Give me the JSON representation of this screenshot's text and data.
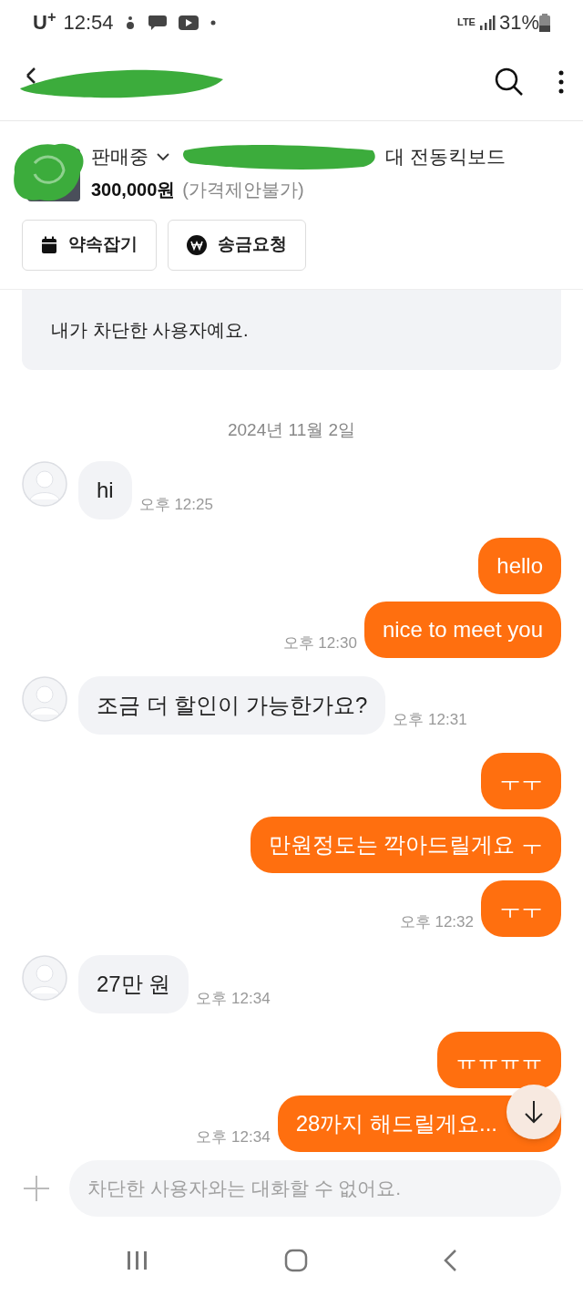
{
  "status_bar": {
    "carrier": "U$^{+}$",
    "time": "12:54",
    "network": "LTE",
    "battery": "31%"
  },
  "product": {
    "status": "판매중",
    "title": "대 전동킥보드",
    "price": "300,000원",
    "note": "(가격제안불가)"
  },
  "actions": [
    {
      "kind": "calendar",
      "label": "약속잡기"
    },
    {
      "kind": "won",
      "label": "송금요청"
    }
  ],
  "notice": "내가 차단한 사용자예요.",
  "date": "2024년 11월 2일",
  "messages": [
    {
      "kind": "received",
      "text": "hi",
      "time": "오후 12:25"
    },
    {
      "kind": "sent",
      "text": "hello"
    },
    {
      "kind": "sent",
      "text": "nice to meet you",
      "time": "오후 12:30"
    },
    {
      "kind": "received",
      "text": "조금 더 할인이 가능한가요?",
      "time": "오후 12:31"
    },
    {
      "kind": "sent",
      "text": "ㅜㅜ"
    },
    {
      "kind": "sent",
      "text": "만원정도는 깍아드릴게요 ㅜ"
    },
    {
      "kind": "sent",
      "text": "ㅜㅜ",
      "time": "오후 12:32"
    },
    {
      "kind": "received",
      "text": "27만 원",
      "time": "오후 12:34"
    },
    {
      "kind": "sent",
      "text": "ㅠㅠㅠㅠ"
    },
    {
      "kind": "sent",
      "text": "28까지 해드릴게요...",
      "time": "오후 12:34"
    }
  ],
  "composer": {
    "placeholder": "차단한 사용자와는 대화할 수 없어요."
  }
}
